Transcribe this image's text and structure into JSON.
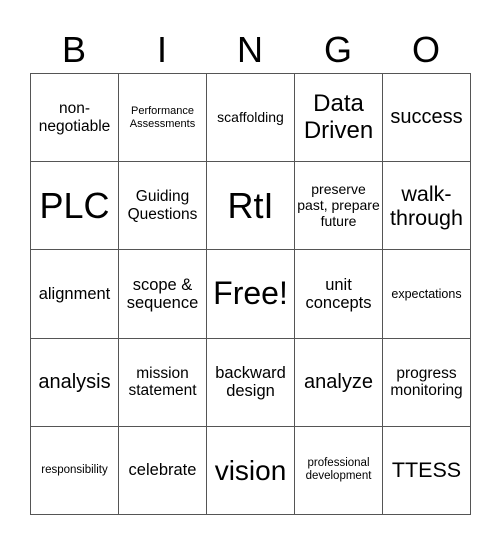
{
  "header": {
    "letters": [
      "B",
      "I",
      "N",
      "G",
      "O"
    ]
  },
  "board": {
    "rows": [
      [
        "non-negotiable",
        "Performance Assessments",
        "scaffolding",
        "Data Driven",
        "success"
      ],
      [
        "PLC",
        "Guiding Questions",
        "RtI",
        "preserve past, prepare future",
        "walk-through"
      ],
      [
        "alignment",
        "scope & sequence",
        "Free!",
        "unit concepts",
        "expectations"
      ],
      [
        "analysis",
        "mission statement",
        "backward design",
        "analyze",
        "progress monitoring"
      ],
      [
        "responsibility",
        "celebrate",
        "vision",
        "professional development",
        "TTESS"
      ]
    ],
    "free_space": "Free!"
  }
}
